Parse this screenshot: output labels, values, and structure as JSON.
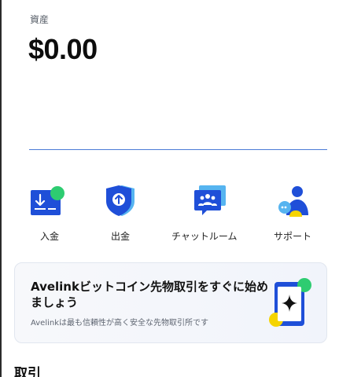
{
  "asset": {
    "label": "資産",
    "value": "$0.00"
  },
  "actions": [
    {
      "label": "入金",
      "icon": "deposit-icon"
    },
    {
      "label": "出金",
      "icon": "withdraw-shield-icon"
    },
    {
      "label": "チャットルーム",
      "icon": "chat-room-icon"
    },
    {
      "label": "サポート",
      "icon": "support-icon"
    }
  ],
  "banner": {
    "title": "Avelinkビットコイン先物取引をすぐに始めましょう",
    "subtitle": "Avelinkは最も信頼性が高く安全な先物取引所です",
    "icon": "sparkle-phone-icon"
  },
  "section": {
    "title": "取引"
  },
  "colors": {
    "primary_blue": "#1f4fd8",
    "light_blue": "#56b4f0",
    "green": "#2ecc71",
    "yellow": "#f5d400",
    "divider": "#4a7bd6"
  }
}
